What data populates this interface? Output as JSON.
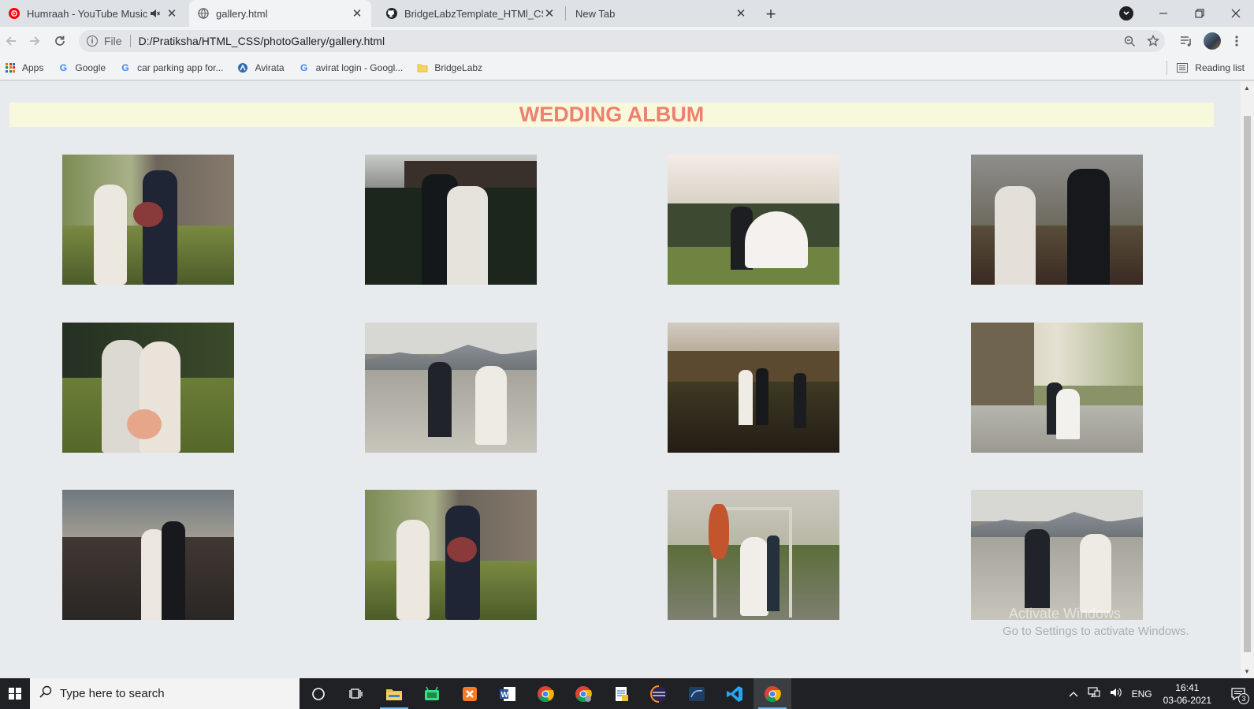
{
  "browser": {
    "tabs": [
      {
        "title": "Humraah - YouTube Music",
        "favicon": "youtube-music-icon",
        "audio": true
      },
      {
        "title": "gallery.html",
        "favicon": "globe-icon",
        "active": true
      },
      {
        "title": "BridgeLabzTemplate_HTMl_CSS/E",
        "favicon": "github-icon"
      },
      {
        "title": "New Tab",
        "favicon": ""
      }
    ],
    "omnibox": {
      "scheme_label": "File",
      "url": "D:/Pratiksha/HTML_CSS/photoGallery/gallery.html"
    },
    "bookmarks": [
      {
        "label": "Apps",
        "icon": "apps-grid-icon"
      },
      {
        "label": "Google",
        "icon": "google-icon"
      },
      {
        "label": "car parking app for...",
        "icon": "google-icon"
      },
      {
        "label": "Avirata",
        "icon": "avirata-icon"
      },
      {
        "label": "avirat login - Googl...",
        "icon": "google-icon"
      },
      {
        "label": "BridgeLabz",
        "icon": "folder-icon"
      }
    ],
    "reading_list_label": "Reading list"
  },
  "page": {
    "title": "WEDDING ALBUM",
    "title_color": "#ee8070",
    "title_bg": "#f8f8dc",
    "background": "#e8ebee",
    "photo_count": 12
  },
  "watermark": {
    "line1": "Activate Windows",
    "line2": "Go to Settings to activate Windows."
  },
  "taskbar": {
    "search_placeholder": "Type here to search",
    "language": "ENG",
    "time": "16:41",
    "date": "03-06-2021",
    "notification_count": "3",
    "apps": [
      "cortana-icon",
      "task-view-icon",
      "file-explorer-icon",
      "android-studio-icon",
      "xampp-icon",
      "word-icon",
      "chrome-icon",
      "chrome-profile-icon",
      "notepad-icon",
      "eclipse-icon",
      "mysql-workbench-icon",
      "vscode-icon",
      "chrome-active-icon"
    ]
  }
}
